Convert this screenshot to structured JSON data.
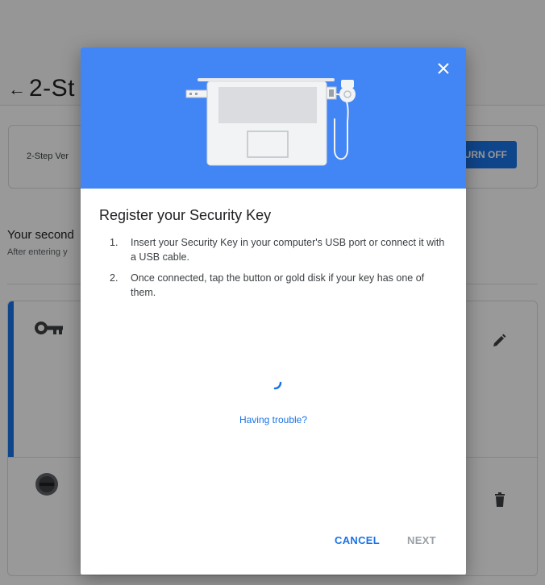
{
  "page": {
    "title": "2-St",
    "back_icon": "arrow-left-icon",
    "status_text": "2-Step Ver",
    "turn_off_label": "URN OFF",
    "section_heading": "Your second",
    "section_sub": "After entering y"
  },
  "dialog": {
    "title": "Register your Security Key",
    "steps": [
      {
        "num": "1.",
        "text": "Insert your Security Key in your computer's USB port or connect it with a USB cable."
      },
      {
        "num": "2.",
        "text": "Once connected, tap the button or gold disk if your key has one of them."
      }
    ],
    "trouble_link": "Having trouble?",
    "cancel_label": "CANCEL",
    "next_label": "NEXT",
    "close_icon": "close-icon",
    "illustration": "laptop-security-key-illustration"
  },
  "colors": {
    "accent": "#1a73e8",
    "hero": "#4285f4",
    "disabled": "#9aa0a6"
  }
}
